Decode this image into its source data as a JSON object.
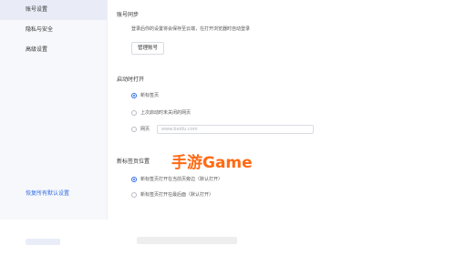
{
  "sidebar": {
    "items": [
      {
        "label": "账号设置"
      },
      {
        "label": "隐私与安全"
      },
      {
        "label": "高级设置"
      }
    ],
    "link": "恢复所有默认设置"
  },
  "sections": {
    "sync": {
      "title": "账号同步",
      "desc": "登录后你的设置将会保存至云端，在打开浏览器时自动登录",
      "button": "管理账号"
    },
    "startup": {
      "title": "启动时打开",
      "options": [
        {
          "label": "新标签页",
          "selected": true
        },
        {
          "label": "上次启动时未关闭的网页",
          "selected": false
        },
        {
          "label": "网页",
          "selected": false
        }
      ],
      "url_placeholder": "www.baidu.com"
    },
    "new_tab": {
      "title": "新标签页位置",
      "options": [
        {
          "label": "新标签页打开在当前页旁边（默认打开）",
          "selected": true
        },
        {
          "label": "新标签页打开在最后面（默认打开）",
          "selected": false
        }
      ]
    }
  },
  "watermark": "手游Game",
  "colors": {
    "accent": "#2f6be6",
    "watermark": "#ff6a13",
    "sidebar_bg": "#f7f8fb"
  }
}
